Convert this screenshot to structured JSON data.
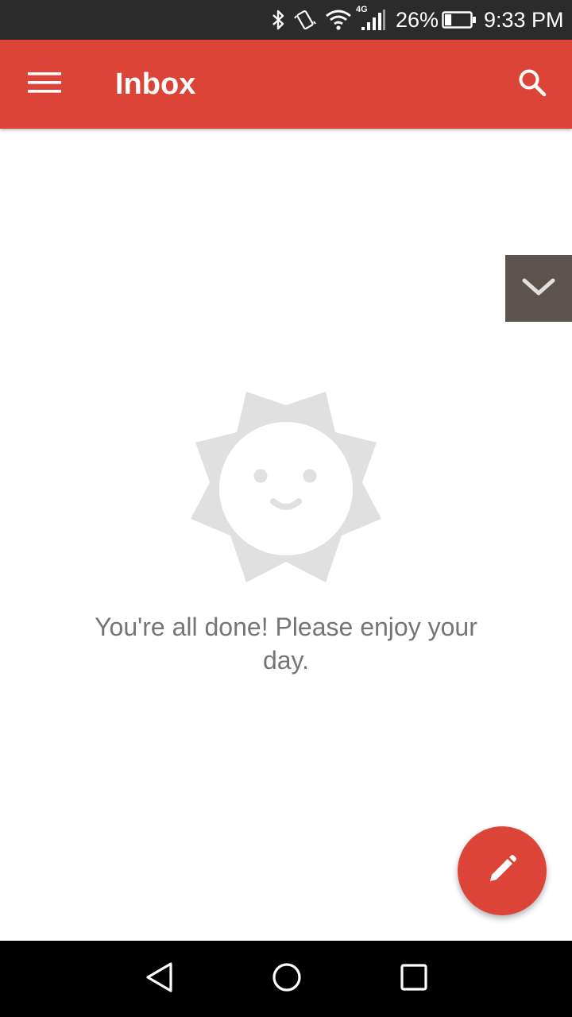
{
  "status_bar": {
    "network_label": "4G",
    "battery_percent": "26%",
    "battery_level": 0.26,
    "time": "9:33 PM",
    "icons": [
      "bluetooth-icon",
      "vibrate-icon",
      "wifi-icon",
      "cell-signal-icon",
      "battery-icon"
    ]
  },
  "app_bar": {
    "title": "Inbox",
    "menu_icon": "hamburger-menu-icon",
    "search_icon": "search-icon",
    "color": "#db4437"
  },
  "empty_state": {
    "illustration": "smiling-sun-icon",
    "message": "You're all done! Please enjoy your day."
  },
  "collapse_tab": {
    "icon": "chevron-down-icon",
    "color": "#5d534e"
  },
  "fab": {
    "icon": "pencil-icon",
    "color": "#db4437"
  },
  "nav_bar": {
    "icons": [
      "back-triangle-icon",
      "home-circle-icon",
      "recents-square-icon"
    ]
  }
}
